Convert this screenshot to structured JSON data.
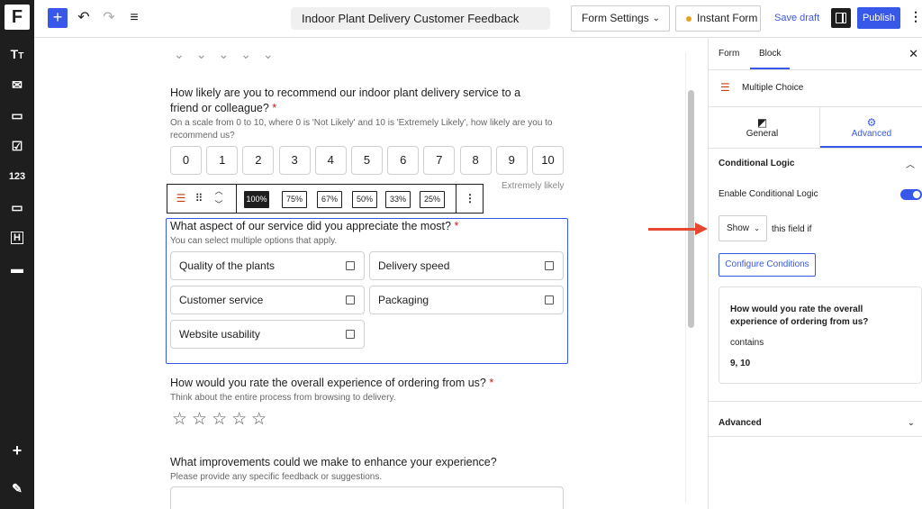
{
  "topbar": {
    "title": "Indoor Plant Delivery Customer Feedback",
    "form_settings": "Form Settings",
    "instant_form": "Instant Form",
    "save_draft": "Save draft",
    "publish": "Publish",
    "accent_color": "#3858e9"
  },
  "rail": {
    "logo": "F",
    "icons": [
      "text-format-icon",
      "mail-icon",
      "tablet-icon",
      "checkbox-icon",
      "number-icon",
      "input-icon",
      "heading-icon",
      "card-icon",
      "plus-icon",
      "pen-icon"
    ],
    "number_label": "123",
    "heading_label": "H"
  },
  "questions": {
    "nps": {
      "title": "How likely are you to recommend our indoor plant delivery service to a friend or colleague?",
      "required_mark": "*",
      "help": "On a scale from 0 to 10, where 0 is 'Not Likely' and 10 is 'Extremely Likely', how likely are you to recommend us?",
      "scale": [
        "0",
        "1",
        "2",
        "3",
        "4",
        "5",
        "6",
        "7",
        "8",
        "9",
        "10"
      ],
      "right_label": "Extremely likely"
    },
    "aspect": {
      "title": "What aspect of our service did you appreciate the most?",
      "required_mark": "*",
      "help": "You can select multiple options that apply.",
      "options": [
        "Quality of the plants",
        "Delivery speed",
        "Customer service",
        "Packaging",
        "Website usability"
      ]
    },
    "rating": {
      "title": "How would you rate the overall experience of ordering from us?",
      "required_mark": "*",
      "help": "Think about the entire process from browsing to delivery.",
      "stars": "☆☆☆☆☆"
    },
    "improvements": {
      "title": "What improvements could we make to enhance your experience?",
      "help": "Please provide any specific feedback or suggestions."
    }
  },
  "block_toolbar": {
    "widths": [
      "100%",
      "75%",
      "67%",
      "50%",
      "33%",
      "25%"
    ],
    "active_width": "100%"
  },
  "sidebar": {
    "tabs": [
      "Form",
      "Block"
    ],
    "active_tab": "Block",
    "block_name": "Multiple Choice",
    "subtabs": [
      "General",
      "Advanced"
    ],
    "active_subtab": "Advanced",
    "conditional_logic": {
      "section_title": "Conditional Logic",
      "enable_label": "Enable Conditional Logic",
      "enabled": true,
      "action_value": "Show",
      "action_suffix": "this field if",
      "configure_button": "Configure Conditions",
      "condition": {
        "question": "How would you rate the overall experience of ordering from us?",
        "operator": "contains",
        "value": "9, 10"
      }
    },
    "advanced_section": "Advanced"
  }
}
